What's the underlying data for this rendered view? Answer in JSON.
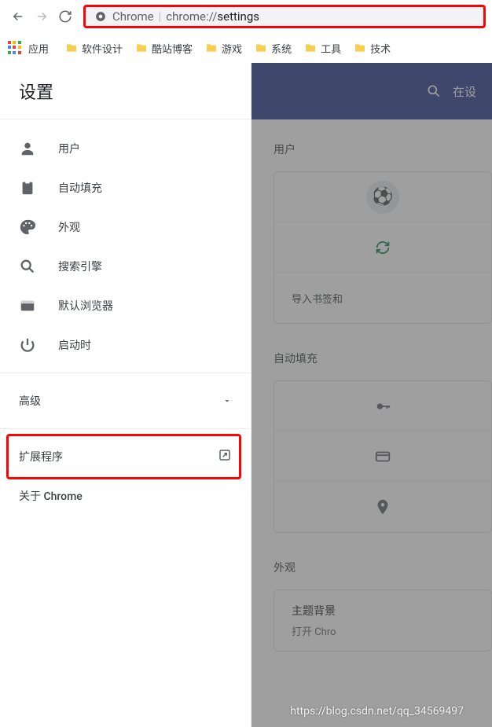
{
  "toolbar": {
    "address_label": "Chrome",
    "url_scheme": "chrome://",
    "url_path": "settings"
  },
  "bookmarks": {
    "apps_label": "应用",
    "items": [
      "软件设计",
      "酷站博客",
      "游戏",
      "系统",
      "工具",
      "技术"
    ]
  },
  "sidebar": {
    "title": "设置",
    "nav": [
      {
        "icon": "person",
        "label": "用户"
      },
      {
        "icon": "clipboard",
        "label": "自动填充"
      },
      {
        "icon": "palette",
        "label": "外观"
      },
      {
        "icon": "search",
        "label": "搜索引擎"
      },
      {
        "icon": "browser",
        "label": "默认浏览器"
      },
      {
        "icon": "power",
        "label": "启动时"
      }
    ],
    "advanced_label": "高级",
    "extensions_label": "扩展程序",
    "about_label": "关于 Chrome"
  },
  "right": {
    "search_placeholder": "在设",
    "sections": {
      "user": {
        "title": "用户",
        "import_text": "导入书签和",
        "avatar_emoji": "⚽"
      },
      "autofill": {
        "title": "自动填充"
      },
      "appearance": {
        "title": "外观",
        "theme_title": "主题背景",
        "theme_sub": "打开 Chro"
      }
    }
  },
  "watermark": "https://blog.csdn.net/qq_34569497",
  "colors": {
    "highlight": "#ff0303",
    "header_blue": "#2a3a8c"
  }
}
